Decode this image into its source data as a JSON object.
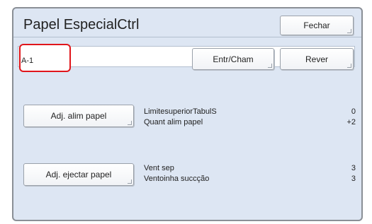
{
  "window": {
    "title": "Papel EspecialCtrl",
    "close_label": "Fechar"
  },
  "toolbar": {
    "identifier": "A-1",
    "entry_call_label": "Entr/Cham",
    "review_label": "Rever"
  },
  "feed_section": {
    "button_label": "Adj. alim papel",
    "rows": [
      {
        "label": "LimitesuperiorTabulS",
        "value": "0"
      },
      {
        "label": "Quant alim papel",
        "value": "+2"
      }
    ]
  },
  "eject_section": {
    "button_label": "Adj. ejectar papel",
    "rows": [
      {
        "label": "Vent sep",
        "value": "3"
      },
      {
        "label": "Ventoinha succção",
        "value": "3"
      }
    ]
  },
  "colors": {
    "panel_bg": "#dde6f3",
    "highlight": "#e0151b"
  }
}
